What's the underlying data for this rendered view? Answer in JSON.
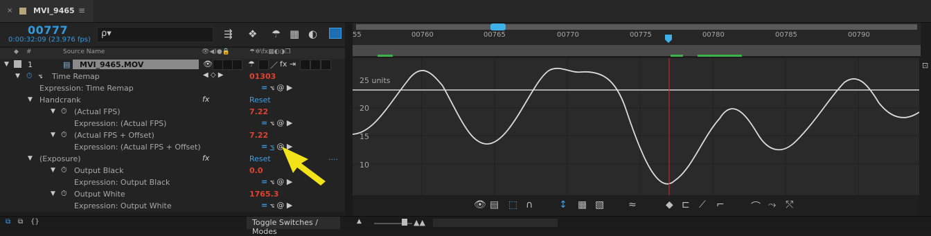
{
  "tab": {
    "close": "×",
    "title": "MVI_9465",
    "menu": "≡"
  },
  "header": {
    "timecode": "00777",
    "timecode_sub": "0:00:32:09 (23.976 fps)",
    "search_placeholder": "ρ▾"
  },
  "columns": {
    "hash": "#",
    "source_name": "Source Name"
  },
  "layer": {
    "index": "1",
    "name": "MVI_9465.MOV"
  },
  "rows": [
    {
      "label": "Time Remap",
      "value": "01303"
    },
    {
      "label": "Expression: Time Remap"
    },
    {
      "label": "Handcrank",
      "value": "Reset"
    },
    {
      "label": "(Actual FPS)",
      "value": "7.22"
    },
    {
      "label": "Expression: (Actual FPS)"
    },
    {
      "label": "(Actual FPS + Offset)",
      "value": "7.22"
    },
    {
      "label": "Expression: (Actual FPS + Offset)"
    },
    {
      "label": "(Exposure)",
      "value": "Reset",
      "more": "...."
    },
    {
      "label": "Output Black",
      "value": "0.0"
    },
    {
      "label": "Expression: Output Black"
    },
    {
      "label": "Output White",
      "value": "1765.3"
    },
    {
      "label": "Expression: Output White"
    }
  ],
  "ruler": {
    "ticks": [
      "55",
      "00760",
      "00765",
      "00770",
      "00775",
      "00780",
      "00785",
      "00790"
    ]
  },
  "graph": {
    "units_label": "25 units",
    "y_labels": [
      "20",
      "15",
      "10"
    ]
  },
  "bottom": {
    "toggle": "Toggle Switches / Modes"
  },
  "colors": {
    "accent": "#2f9be0",
    "value": "#e0432f",
    "playhead": "#d8262a",
    "arrow": "#f2e21a"
  }
}
